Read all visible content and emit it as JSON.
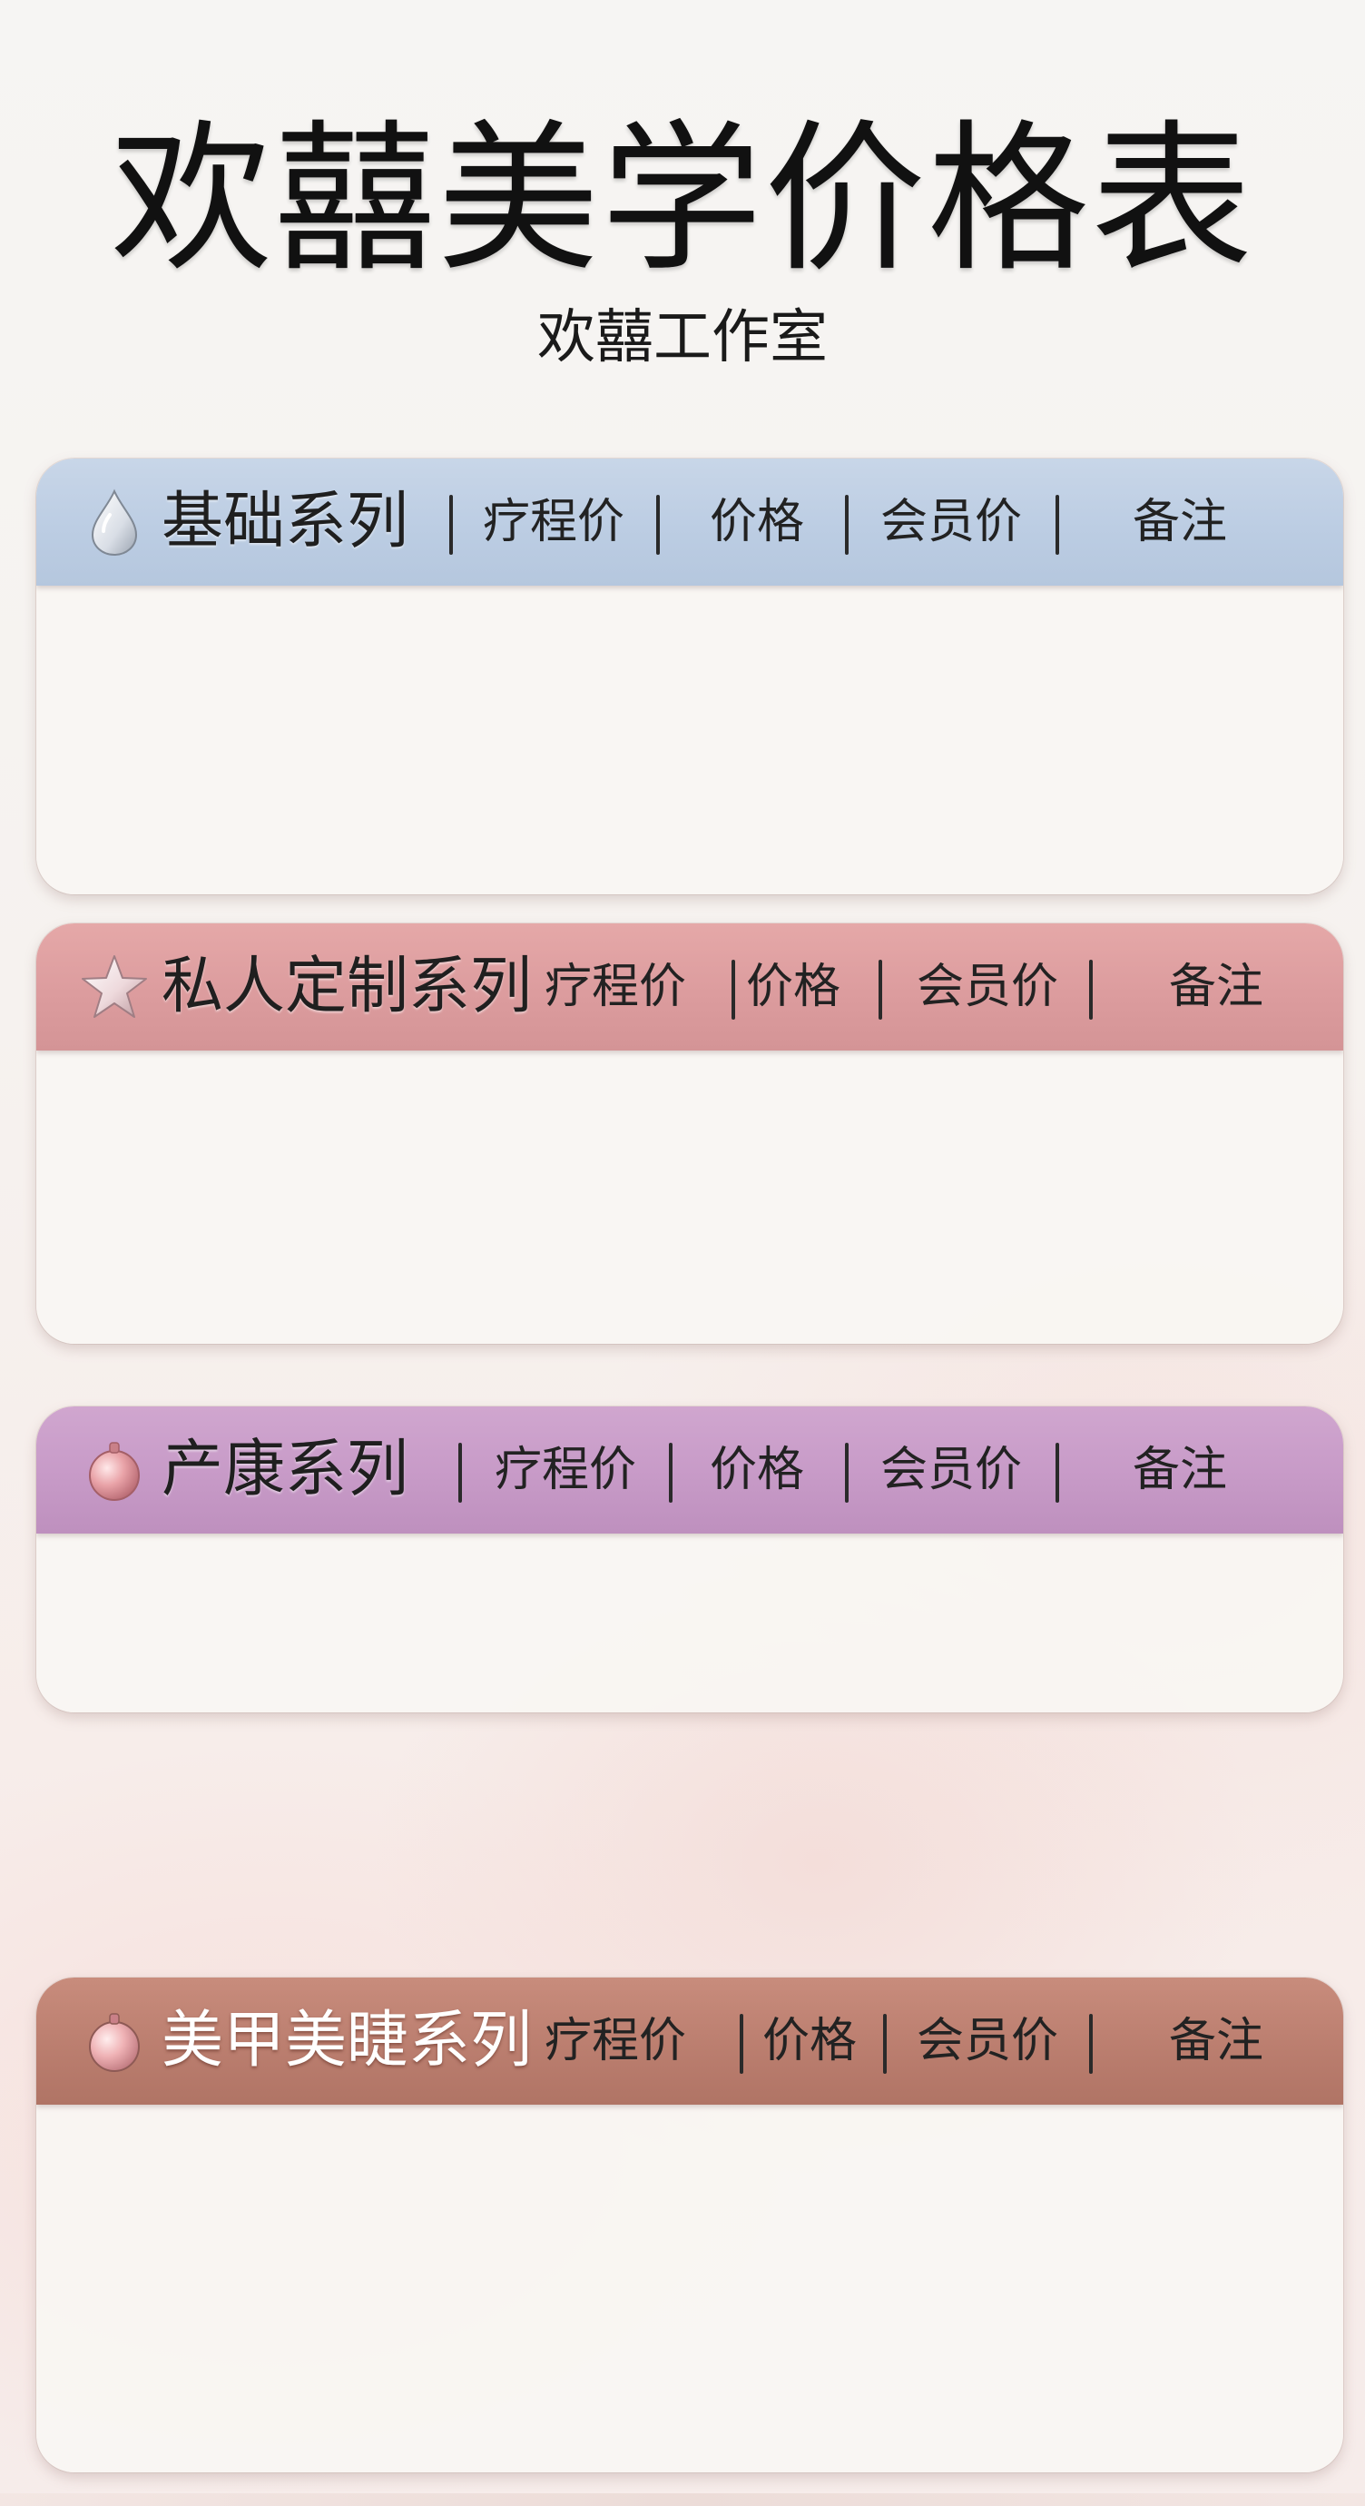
{
  "header": {
    "title": "欢囍美学价格表",
    "subtitle": "欢囍工作室"
  },
  "columns": {
    "course_price": "疗程价",
    "price": "价格",
    "member_price": "会员价",
    "notes": "备注"
  },
  "sections": [
    {
      "name": "基础系列",
      "icon": "water-drop-icon",
      "color": "#bccde3"
    },
    {
      "name": "私人定制系列",
      "icon": "star-icon",
      "color": "#dc9c9e"
    },
    {
      "name": "产康系列",
      "icon": "pink-orb-icon",
      "color": "#c79ac7"
    },
    {
      "name": "美甲美睫系列",
      "icon": "pink-orb-icon",
      "color": "#bb7e6f"
    }
  ]
}
